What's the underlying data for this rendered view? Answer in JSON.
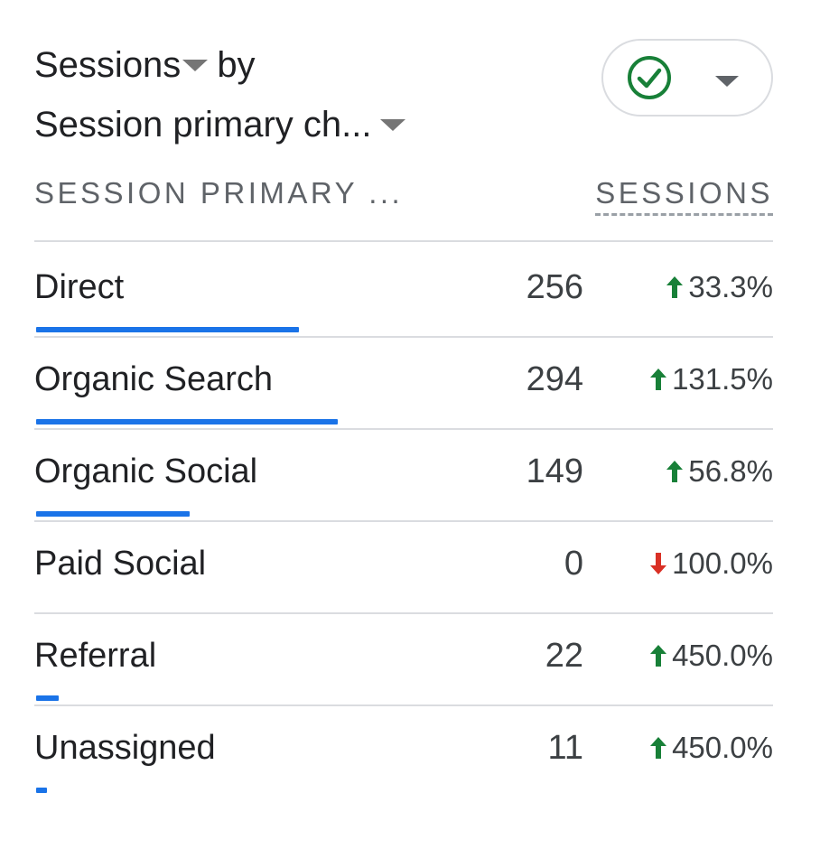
{
  "header": {
    "metric_label": "Sessions",
    "by_label": "by",
    "dimension_label": "Session primary ch..."
  },
  "filter": {
    "icon": "check-circle-icon",
    "status_color": "#188038"
  },
  "table": {
    "dimension_header": "SESSION PRIMARY ...",
    "metric_header": "SESSIONS",
    "rows": [
      {
        "label": "Direct",
        "value": "256",
        "change": "33.3%",
        "direction": "up",
        "bar_fraction": 0.87
      },
      {
        "label": "Organic Search",
        "value": "294",
        "change": "131.5%",
        "direction": "up",
        "bar_fraction": 1.0
      },
      {
        "label": "Organic Social",
        "value": "149",
        "change": "56.8%",
        "direction": "up",
        "bar_fraction": 0.51
      },
      {
        "label": "Paid Social",
        "value": "0",
        "change": "100.0%",
        "direction": "down",
        "bar_fraction": 0
      },
      {
        "label": "Referral",
        "value": "22",
        "change": "450.0%",
        "direction": "up",
        "bar_fraction": 0.075
      },
      {
        "label": "Unassigned",
        "value": "11",
        "change": "450.0%",
        "direction": "up",
        "bar_fraction": 0.037
      }
    ]
  },
  "colors": {
    "up": "#188038",
    "down": "#d93025",
    "bar": "#1a73e8"
  }
}
